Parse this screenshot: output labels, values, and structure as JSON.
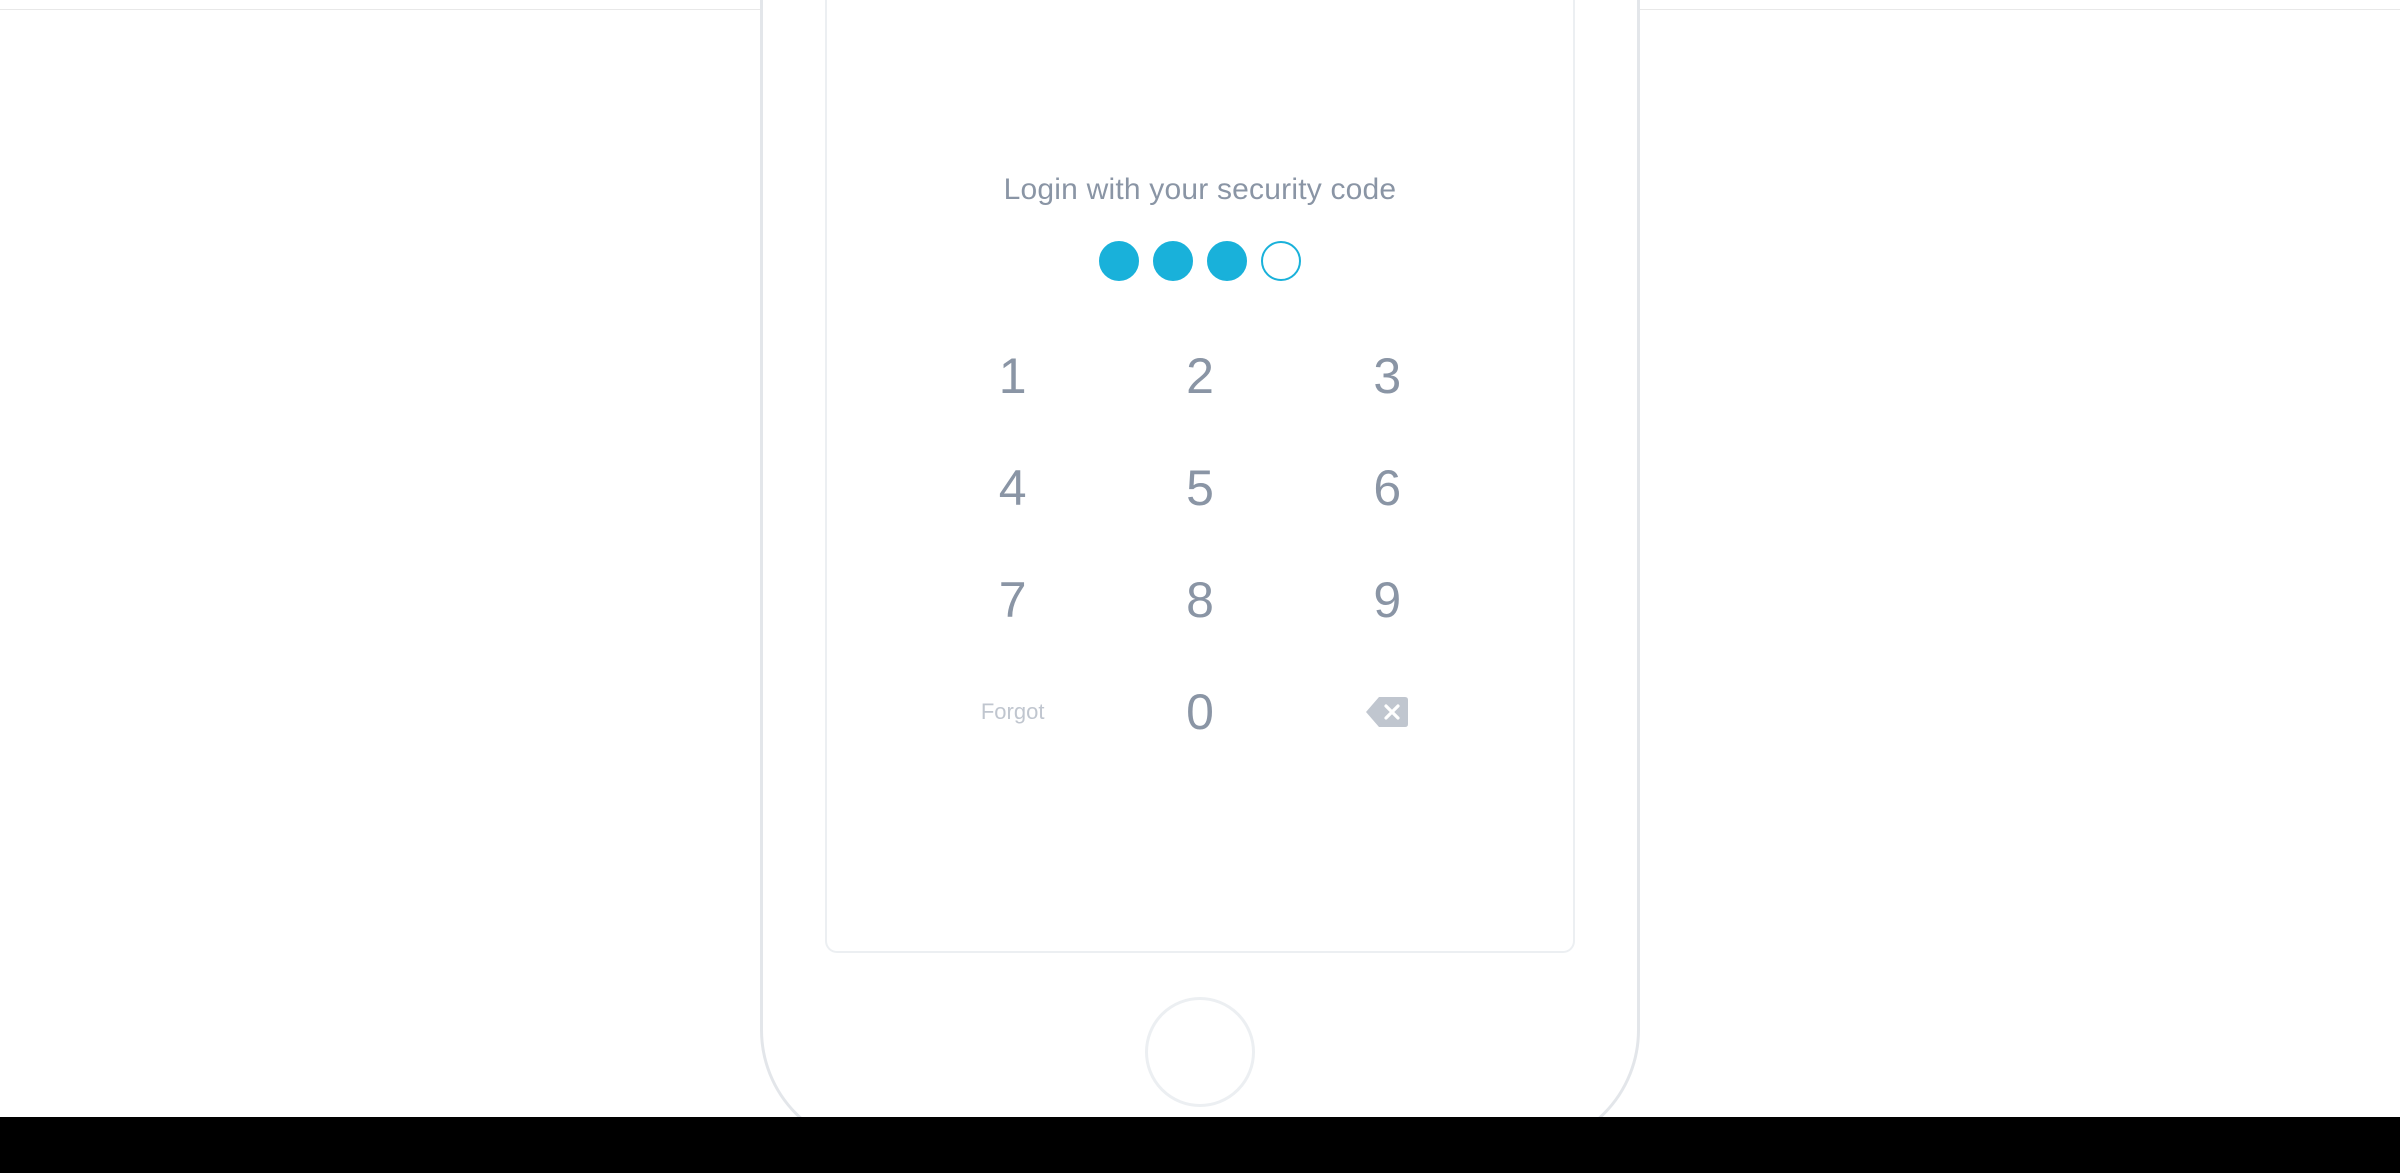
{
  "prompt": "Login with your security code",
  "pin": {
    "length": 4,
    "entered": 3
  },
  "keypad": {
    "k1": "1",
    "k2": "2",
    "k3": "3",
    "k4": "4",
    "k5": "5",
    "k6": "6",
    "k7": "7",
    "k8": "8",
    "k9": "9",
    "k0": "0",
    "forgot": "Forgot"
  },
  "colors": {
    "accent": "#19b1da",
    "key": "#8a95a5",
    "muted": "#c0c6cf",
    "frame": "#e3e6ea"
  }
}
